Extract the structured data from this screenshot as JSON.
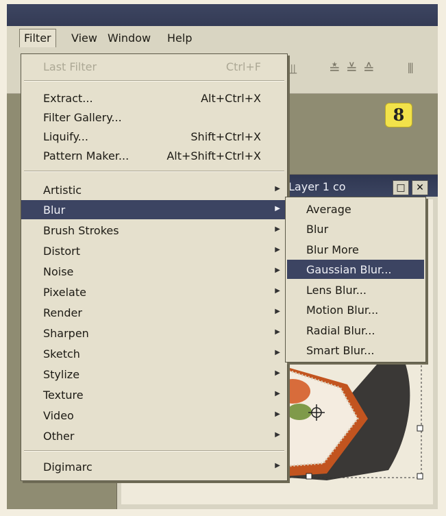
{
  "menubar": {
    "items": [
      "Filter",
      "View",
      "Window",
      "Help"
    ]
  },
  "badge": "8",
  "document_window": {
    "title": "Layer 1 co",
    "buttons": [
      "□",
      "✕"
    ]
  },
  "filter_menu": {
    "last_filter": {
      "label": "Last Filter",
      "shortcut": "Ctrl+F"
    },
    "group1": [
      {
        "label": "Extract...",
        "shortcut": "Alt+Ctrl+X"
      },
      {
        "label": "Filter Gallery...",
        "shortcut": ""
      },
      {
        "label": "Liquify...",
        "shortcut": "Shift+Ctrl+X"
      },
      {
        "label": "Pattern Maker...",
        "shortcut": "Alt+Shift+Ctrl+X"
      }
    ],
    "submenus": [
      "Artistic",
      "Blur",
      "Brush Strokes",
      "Distort",
      "Noise",
      "Pixelate",
      "Render",
      "Sharpen",
      "Sketch",
      "Stylize",
      "Texture",
      "Video",
      "Other"
    ],
    "last_group": [
      "Digimarc"
    ]
  },
  "blur_submenu": {
    "items": [
      "Average",
      "Blur",
      "Blur More",
      "Gaussian Blur...",
      "Lens Blur...",
      "Motion Blur...",
      "Radial Blur...",
      "Smart Blur..."
    ]
  }
}
